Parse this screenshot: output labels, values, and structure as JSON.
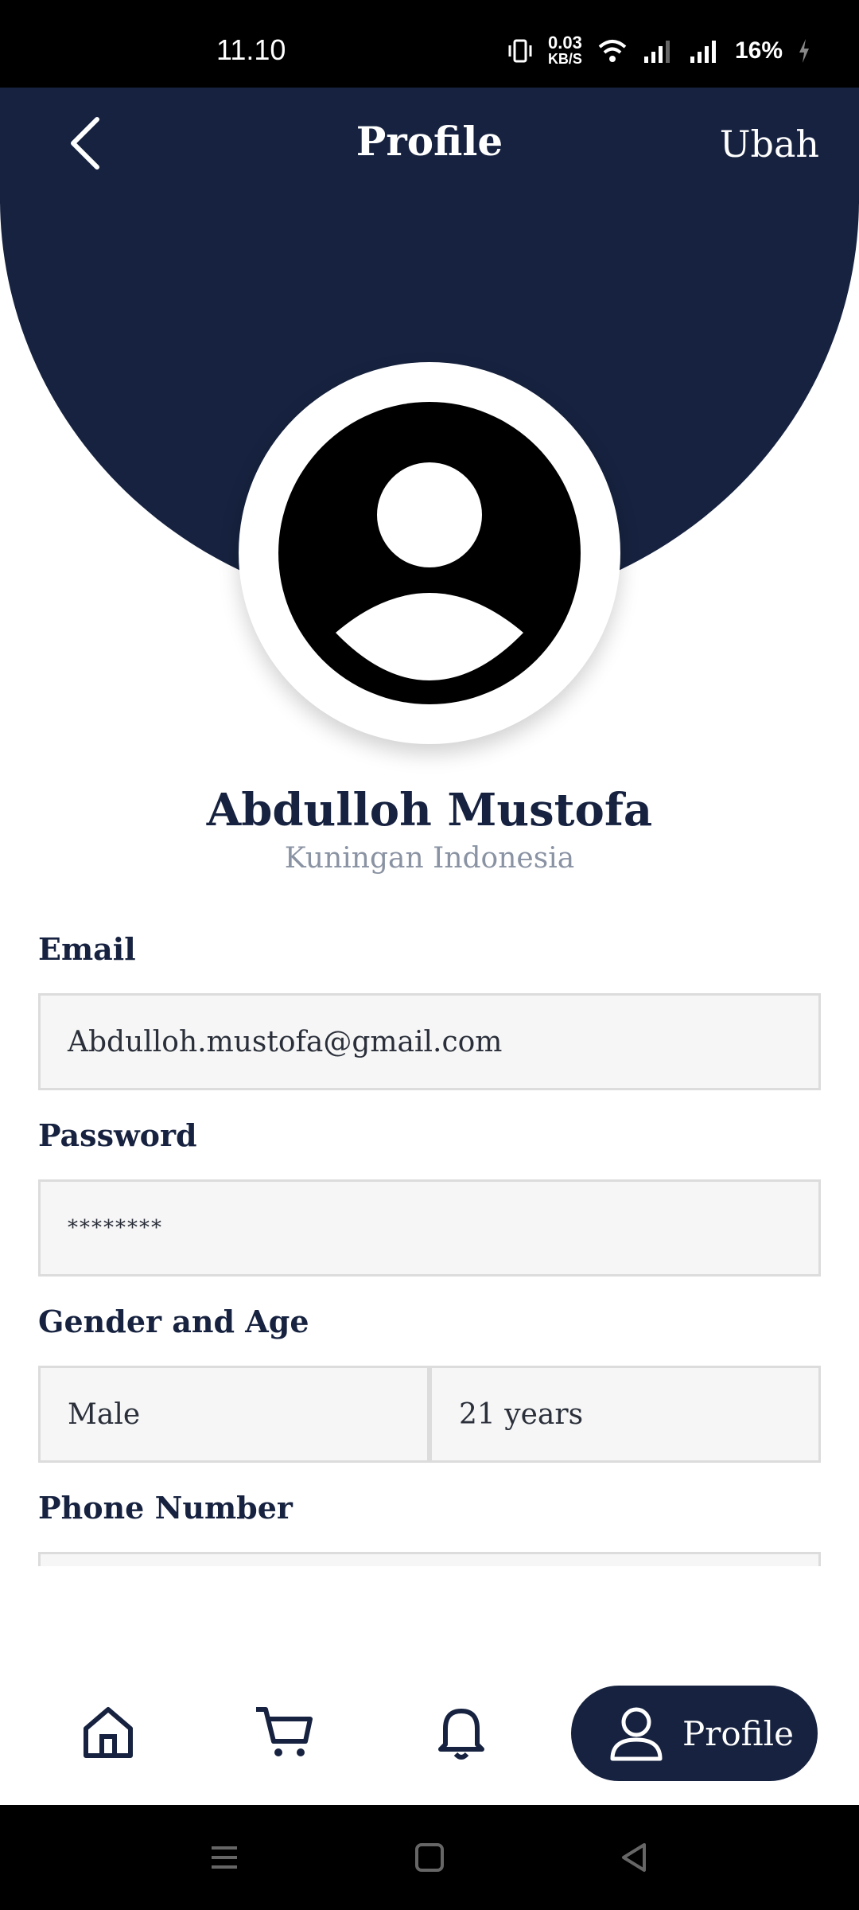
{
  "status_bar": {
    "time": "11.10",
    "net_speed_value": "0.03",
    "net_speed_unit": "KB/S",
    "battery": "16%"
  },
  "app_bar": {
    "title": "Profile",
    "edit_label": "Ubah"
  },
  "user": {
    "name": "Abdulloh Mustofa",
    "location": "Kuningan Indonesia"
  },
  "form": {
    "email_label": "Email",
    "email_value": "Abdulloh.mustofa@gmail.com",
    "password_label": "Password",
    "password_value": "********",
    "gender_age_label": "Gender and Age",
    "gender_value": "Male",
    "age_value": "21 years",
    "phone_label": "Phone Number",
    "phone_value": ""
  },
  "bottom_nav": {
    "items": [
      {
        "icon": "home-icon"
      },
      {
        "icon": "cart-icon"
      },
      {
        "icon": "bell-icon"
      },
      {
        "icon": "user-icon",
        "label": "Profile",
        "active": true
      }
    ]
  },
  "colors": {
    "primary": "#16223f",
    "field_bg": "#f6f6f6",
    "muted": "#8a93a3"
  }
}
